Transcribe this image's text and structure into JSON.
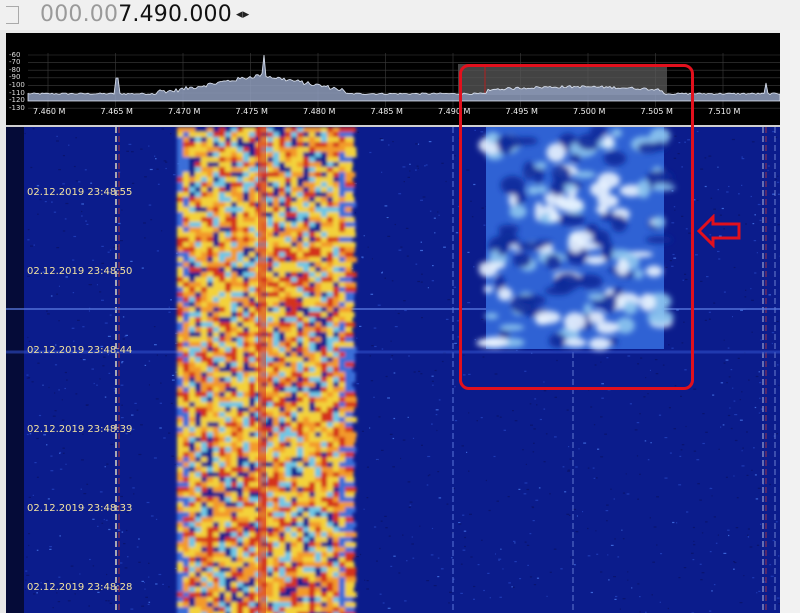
{
  "frequency": {
    "dim_part": "000.00",
    "main_part": "7.490.000",
    "arrows": "◂▸"
  },
  "spectrum": {
    "db_labels": [
      "-60",
      "-70",
      "-80",
      "-90",
      "-100",
      "-110",
      "-120",
      "-130"
    ],
    "freq_labels": [
      "7.460 M",
      "7.465 M",
      "7.470 M",
      "7.475 M",
      "7.480 M",
      "7.485 M",
      "7.490 M",
      "7.495 M",
      "7.500 M",
      "7.505 M",
      "7.510 M"
    ]
  },
  "waterfall": {
    "timestamps": [
      "02.12.2019 23:48:55",
      "02.12.2019 23:48:50",
      "02.12.2019 23:48:44",
      "02.12.2019 23:48:39",
      "02.12.2019 23:48:33",
      "02.12.2019 23:48:28"
    ]
  },
  "annotation": {
    "box_color": "#e2101d",
    "arrow_icon": "left-arrow-icon"
  },
  "colors": {
    "waterfall_bg": "#0a1a8a",
    "signal_hot": "#d4321e",
    "signal_warm": "#f2c232",
    "spectrum_fill": "#9aa9c9"
  }
}
